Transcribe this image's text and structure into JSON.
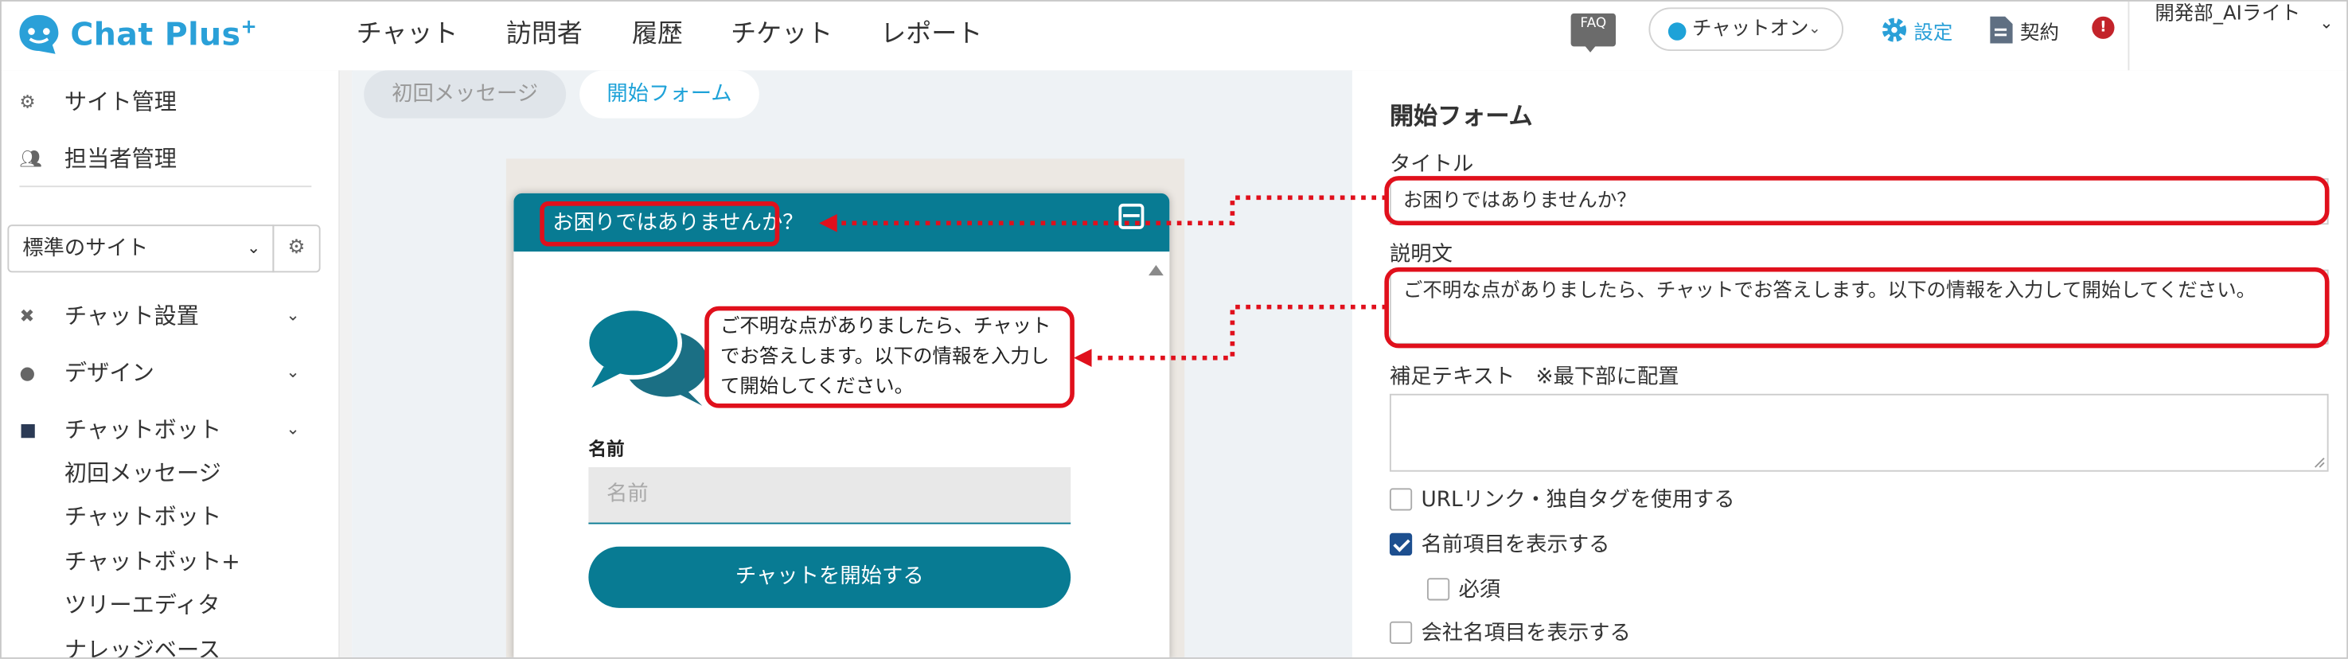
{
  "header": {
    "logo_text": "Chat Plus",
    "logo_sup": "+",
    "nav": [
      "チャット",
      "訪問者",
      "履歴",
      "チケット",
      "レポート"
    ],
    "faq_label": "FAQ",
    "chat_status": "チャットオン",
    "settings_label": "設定",
    "contract_label": "契約",
    "alert_mark": "!",
    "user_name": "開発部_AIライト"
  },
  "sidebar": {
    "site_admin": "サイト管理",
    "staff_admin": "担当者管理",
    "site_select": "標準のサイト",
    "sections": [
      "チャット設置",
      "デザイン",
      "チャットボット"
    ],
    "chatbot_items": [
      "初回メッセージ",
      "チャットボット",
      "チャットボット+",
      "ツリーエディタ",
      "ナレッジベース"
    ]
  },
  "tabs": {
    "first_message": "初回メッセージ",
    "start_form": "開始フォーム"
  },
  "widget": {
    "title": "お困りではありませんか？",
    "description": "ご不明な点がありましたら、チャットでお答えします。以下の情報を入力して開始してください。",
    "name_label": "名前",
    "name_placeholder": "名前",
    "start_button": "チャットを開始する"
  },
  "form": {
    "heading": "開始フォーム",
    "title_label": "タイトル",
    "title_value": "お困りではありませんか？",
    "desc_label": "説明文",
    "desc_value": "ご不明な点がありましたら、チャットでお答えします。以下の情報を入力して開始してください。",
    "extra_label": "補足テキスト　※最下部に配置",
    "extra_value": "",
    "checkboxes": [
      {
        "label": "URLリンク・独自タグを使用する",
        "checked": false
      },
      {
        "label": "名前項目を表示する",
        "checked": true
      },
      {
        "label": "必須",
        "checked": false
      },
      {
        "label": "会社名項目を表示する",
        "checked": false
      }
    ]
  },
  "colors": {
    "brand": "#2aa0d8",
    "widget_teal": "#087b93",
    "annotation_red": "#e0101c",
    "checkbox_on": "#1d4f8f"
  }
}
